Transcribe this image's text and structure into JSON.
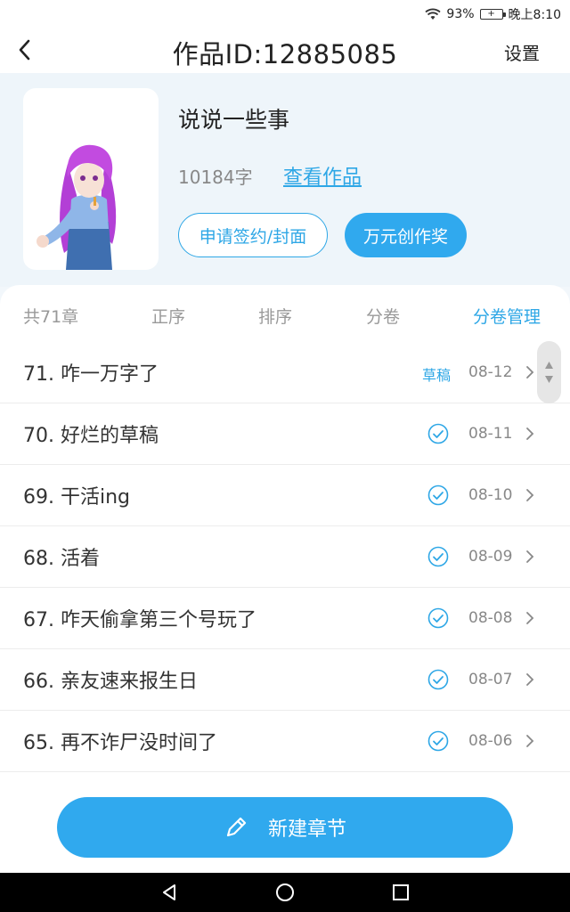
{
  "status_bar": {
    "battery_percent": "93%",
    "time": "晚上8:10"
  },
  "title_bar": {
    "title": "作品ID:12885085",
    "settings_label": "设置"
  },
  "work": {
    "title": "说说一些事",
    "word_count": "10184字",
    "view_link": "查看作品",
    "apply_button": "申请签约/封面",
    "award_button": "万元创作奖"
  },
  "tabs": {
    "count": "共71章",
    "items": [
      "正序",
      "排序",
      "分卷",
      "分卷管理"
    ]
  },
  "chapters": [
    {
      "title": "71. 咋一万字了",
      "status": "草稿",
      "date": "08-12"
    },
    {
      "title": "70. 好烂的草稿",
      "status": "published",
      "date": "08-11"
    },
    {
      "title": "69. 干活ing",
      "status": "published",
      "date": "08-10"
    },
    {
      "title": "68. 活着",
      "status": "published",
      "date": "08-09"
    },
    {
      "title": "67. 咋天偷拿第三个号玩了",
      "status": "published",
      "date": "08-08"
    },
    {
      "title": "66. 亲友速来报生日",
      "status": "published",
      "date": "08-07"
    },
    {
      "title": "65. 再不诈尸没时间了",
      "status": "published",
      "date": "08-06"
    }
  ],
  "new_chapter_button": "新建章节",
  "colors": {
    "accent": "#30a9ee",
    "link": "#2ea7e6"
  }
}
